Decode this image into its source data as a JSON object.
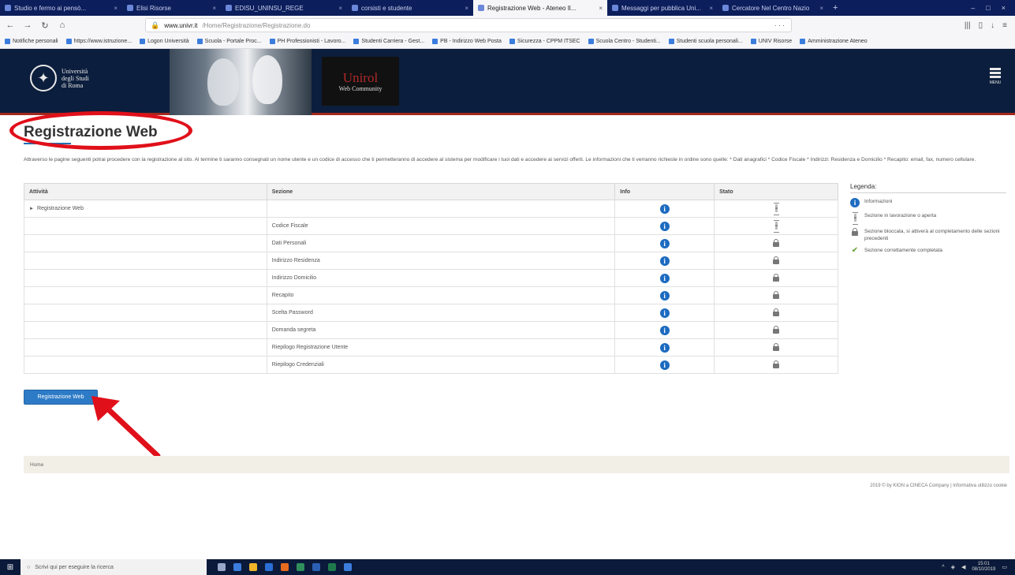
{
  "browser": {
    "tabs": [
      {
        "label": "Studio e fermo ai pensò...",
        "active": false
      },
      {
        "label": "Elisi Risorse",
        "active": false
      },
      {
        "label": "EDISU_UNINSU_REGE",
        "active": false
      },
      {
        "label": "corsisti e studente",
        "active": false
      },
      {
        "label": "Registrazione Web - Ateneo Il...",
        "active": true
      },
      {
        "label": "Messaggi per pubblica Uni...",
        "active": false
      },
      {
        "label": "Cercatore Nel Centro Nazio",
        "active": false
      }
    ],
    "new_tab": "+",
    "window_controls": [
      "–",
      "□",
      "×"
    ],
    "url_host": "www.univr.it",
    "url_rest": "/Home/Registrazione/Registrazione.do",
    "bookmarks": [
      "Notifiche personali",
      "https://www.istruzione...",
      "Logon Università",
      "Scuola - Portale Proc...",
      "PH Professionisti - Lavoro...",
      "Studenti Carriera - Gest...",
      "PB - Indirizzo Web Posta",
      "Sicurezza - CPPM ITSEC",
      "Scuola Centro - Studenti...",
      "Studenti scuola personali...",
      "UNIV Risorse",
      "Amministrazione Ateneo"
    ]
  },
  "site": {
    "university_name": [
      "Università",
      "degli Studi",
      "di Roma"
    ],
    "brand_main": "Unirol",
    "brand_sub": "Web Community",
    "menu_label": "MENU"
  },
  "page": {
    "title": "Registrazione Web",
    "intro": "Attraverso le pagine seguenti potrai procedere con la registrazione al sito. Al termine ti saranno consegnati un nome utente e un codice di accesso che ti permetteranno di accedere al sistema per modificare i tuoi dati e accedere ai servizi offerti. Le informazioni che ti verranno richieste in ordine sono quelle: * Dati anagrafici * Codice Fiscale * Indirizzi: Residenza e Domicilio * Recapito: email, fax, numero cellulare."
  },
  "table": {
    "headers": {
      "activity": "Attività",
      "section": "Sezione",
      "info": "Info",
      "status": "Stato"
    },
    "rows": [
      {
        "activity": "Registrazione Web",
        "section": "",
        "status": "hourglass"
      },
      {
        "activity": "",
        "section": "Codice Fiscale",
        "status": "hourglass"
      },
      {
        "activity": "",
        "section": "Dati Personali",
        "status": "lock"
      },
      {
        "activity": "",
        "section": "Indirizzo Residenza",
        "status": "lock"
      },
      {
        "activity": "",
        "section": "Indirizzo Domicilio",
        "status": "lock"
      },
      {
        "activity": "",
        "section": "Recapito",
        "status": "lock"
      },
      {
        "activity": "",
        "section": "Scelta Password",
        "status": "lock"
      },
      {
        "activity": "",
        "section": "Domanda segreta",
        "status": "lock"
      },
      {
        "activity": "",
        "section": "Riepilogo Registrazione Utente",
        "status": "lock"
      },
      {
        "activity": "",
        "section": "Riepilogo Credenziali",
        "status": "lock"
      }
    ],
    "expand_glyph": "►",
    "info_glyph": "i"
  },
  "legend": {
    "title": "Legenda:",
    "items": [
      {
        "icon": "info-icon",
        "text": "Informazioni"
      },
      {
        "icon": "hourglass-icon",
        "text": "Sezione in lavorazione o aperta"
      },
      {
        "icon": "lock-icon",
        "text": "Sezione bloccata, si attiverà al completamento delle sezioni precedenti"
      },
      {
        "icon": "check-icon",
        "text": "Sezione correttamente completata"
      }
    ]
  },
  "actions": {
    "register_button": "Registrazione Web"
  },
  "footer": {
    "left": "Home",
    "right": "2019 © by KION a CINECA Company | Informativa utilizzo cookie"
  },
  "taskbar": {
    "search_placeholder": "Scrivi qui per eseguire la ricerca",
    "clock_time": "15:01",
    "clock_date": "08/10/2019"
  },
  "colors": {
    "annotation_red": "#e0101a",
    "primary_blue": "#2d7bc6",
    "header_navy": "#0c1e3d"
  }
}
